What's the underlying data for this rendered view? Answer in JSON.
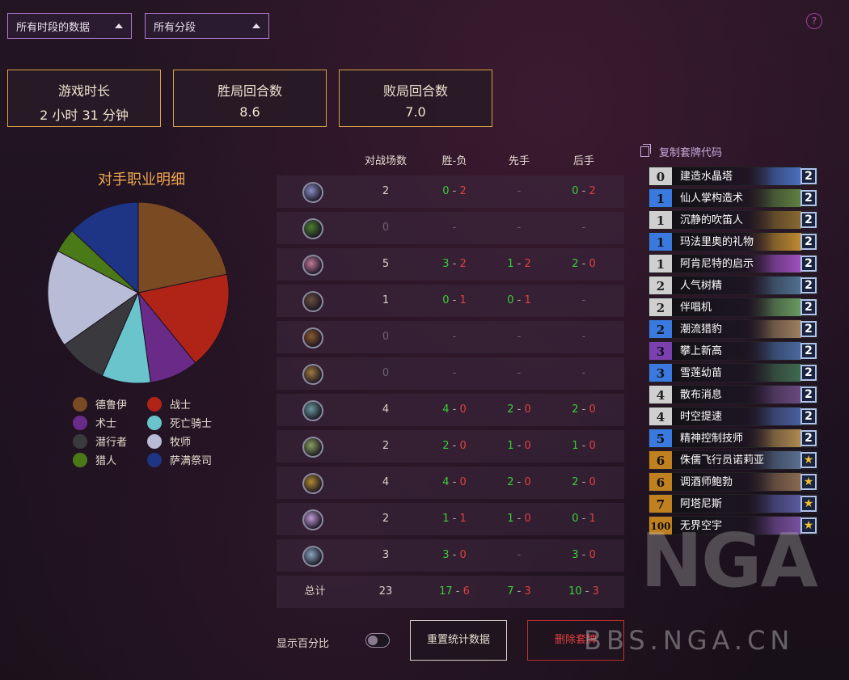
{
  "filters": {
    "period": "所有时段的数据",
    "rank": "所有分段"
  },
  "help_label": "?",
  "stats": [
    {
      "label": "游戏时长",
      "value": "2 小时 31 分钟"
    },
    {
      "label": "胜局回合数",
      "value": "8.6"
    },
    {
      "label": "败局回合数",
      "value": "7.0"
    }
  ],
  "pie": {
    "title": "对手职业明细",
    "chart_data": {
      "type": "pie",
      "labels": [
        "德鲁伊",
        "战士",
        "术士",
        "死亡骑士",
        "潜行者",
        "牧师",
        "猎人",
        "萨满祭司"
      ],
      "values": [
        5,
        4,
        2,
        2,
        2,
        4,
        1,
        3
      ],
      "colors": [
        "#7a4a22",
        "#b02418",
        "#6a2a88",
        "#6ac4cc",
        "#3a3a3e",
        "#b8bcd6",
        "#4a7a18",
        "#1e3484"
      ]
    }
  },
  "table": {
    "headers": [
      "对战场数",
      "胜-负",
      "先手",
      "后手"
    ],
    "rows": [
      {
        "icon": "warrior-class-icon",
        "color": "#8a8ec8",
        "games": "2",
        "w": "0",
        "l": "2",
        "fw": "-",
        "fl": "",
        "sw": "0",
        "sl": "2"
      },
      {
        "icon": "hunter-class-icon",
        "color": "#4a8030",
        "games": "0",
        "w": "-",
        "l": "",
        "fw": "-",
        "fl": "",
        "sw": "-",
        "sl": ""
      },
      {
        "icon": "mage-class-icon",
        "color": "#c07a9a",
        "games": "5",
        "w": "3",
        "l": "2",
        "fw": "1",
        "fl": "2",
        "sw": "2",
        "sl": "0"
      },
      {
        "icon": "rogue-class-icon",
        "color": "#6a5040",
        "games": "1",
        "w": "0",
        "l": "1",
        "fw": "0",
        "fl": "1",
        "sw": "-",
        "sl": ""
      },
      {
        "icon": "druid-class-icon",
        "color": "#8a5a30",
        "games": "0",
        "w": "-",
        "l": "",
        "fw": "-",
        "fl": "",
        "sw": "-",
        "sl": ""
      },
      {
        "icon": "paladin-class-icon",
        "color": "#a07a40",
        "games": "0",
        "w": "-",
        "l": "",
        "fw": "-",
        "fl": "",
        "sw": "-",
        "sl": ""
      },
      {
        "icon": "demon-hunter-class-icon",
        "color": "#6a9aa0",
        "games": "4",
        "w": "4",
        "l": "0",
        "fw": "2",
        "fl": "0",
        "sw": "2",
        "sl": "0"
      },
      {
        "icon": "shaman-class-icon",
        "color": "#8aa060",
        "games": "2",
        "w": "2",
        "l": "0",
        "fw": "1",
        "fl": "0",
        "sw": "1",
        "sl": "0"
      },
      {
        "icon": "warlock-class-icon",
        "color": "#b08a30",
        "games": "4",
        "w": "4",
        "l": "0",
        "fw": "2",
        "fl": "0",
        "sw": "2",
        "sl": "0"
      },
      {
        "icon": "priest-class-icon",
        "color": "#c09ad8",
        "games": "2",
        "w": "1",
        "l": "1",
        "fw": "1",
        "fl": "0",
        "sw": "0",
        "sl": "1"
      },
      {
        "icon": "death-knight-class-icon",
        "color": "#8aa8c0",
        "games": "3",
        "w": "3",
        "l": "0",
        "fw": "-",
        "fl": "",
        "sw": "3",
        "sl": "0"
      }
    ],
    "total": {
      "label": "总计",
      "games": "23",
      "w": "17",
      "l": "6",
      "fw": "7",
      "fl": "3",
      "sw": "10",
      "sl": "3"
    },
    "dash": "-"
  },
  "deck": {
    "copy_label": "复制套牌代码",
    "cards": [
      {
        "cost": "0",
        "name": "建造水晶塔",
        "count": "2",
        "rarity": "#cfcfcf",
        "art": "#4a70c0"
      },
      {
        "cost": "1",
        "name": "仙人掌构造术",
        "count": "2",
        "rarity": "#3a7ae0",
        "art": "#608040"
      },
      {
        "cost": "1",
        "name": "沉静的吹笛人",
        "count": "2",
        "rarity": "#cfcfcf",
        "art": "#8a6a30"
      },
      {
        "cost": "1",
        "name": "玛法里奥的礼物",
        "count": "2",
        "rarity": "#3a7ae0",
        "art": "#c08a30"
      },
      {
        "cost": "1",
        "name": "阿肯尼特的启示",
        "count": "2",
        "rarity": "#cfcfcf",
        "art": "#a050c0"
      },
      {
        "cost": "2",
        "name": "人气树精",
        "count": "2",
        "rarity": "#cfcfcf",
        "art": "#507090"
      },
      {
        "cost": "2",
        "name": "伴唱机",
        "count": "2",
        "rarity": "#cfcfcf",
        "art": "#6a9a60"
      },
      {
        "cost": "2",
        "name": "潮流猎豹",
        "count": "2",
        "rarity": "#3a7ae0",
        "art": "#a08060"
      },
      {
        "cost": "3",
        "name": "攀上新高",
        "count": "2",
        "rarity": "#7a40b0",
        "art": "#4a6aa0"
      },
      {
        "cost": "3",
        "name": "雪莲幼苗",
        "count": "2",
        "rarity": "#3a7ae0",
        "art": "#406a50"
      },
      {
        "cost": "4",
        "name": "散布消息",
        "count": "2",
        "rarity": "#cfcfcf",
        "art": "#6a4a80"
      },
      {
        "cost": "4",
        "name": "时空提速",
        "count": "2",
        "rarity": "#cfcfcf",
        "art": "#4a60a0"
      },
      {
        "cost": "5",
        "name": "精神控制技师",
        "count": "2",
        "rarity": "#3a7ae0",
        "art": "#b08a50"
      },
      {
        "cost": "6",
        "name": "侏儒飞行员诺莉亚",
        "count": "★",
        "rarity": "#c08020",
        "art": "#5a7090"
      },
      {
        "cost": "6",
        "name": "调酒师鲍勃",
        "count": "★",
        "rarity": "#c08020",
        "art": "#8a6a50"
      },
      {
        "cost": "7",
        "name": "阿塔尼斯",
        "count": "★",
        "rarity": "#c08020",
        "art": "#5a5aa0"
      },
      {
        "cost": "100",
        "name": "无界空宇",
        "count": "★",
        "rarity": "#c08020",
        "art": "#7a50a0"
      }
    ]
  },
  "footer": {
    "show_percent": "显示百分比",
    "reset_button": "重置统计数据",
    "delete_button": "删除套牌"
  },
  "watermark": {
    "logo": "NGA",
    "site": "BBS.NGA.CN"
  }
}
